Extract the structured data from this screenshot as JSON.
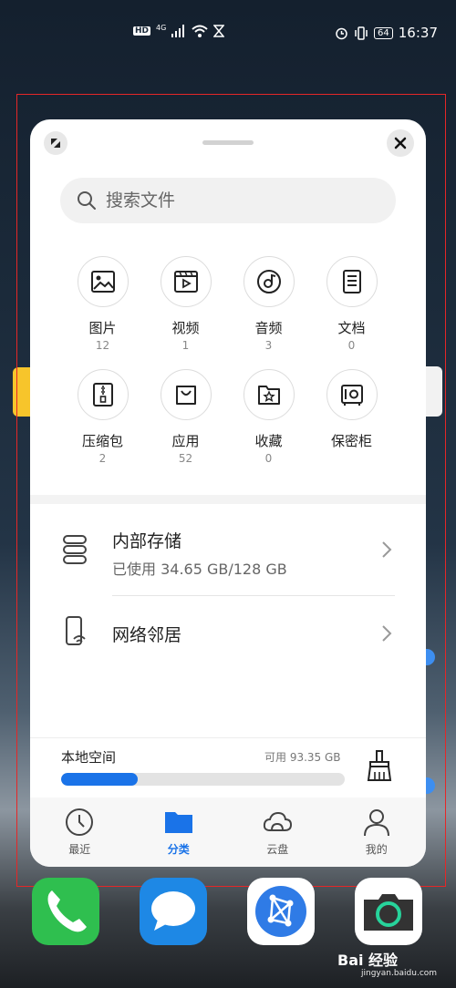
{
  "status_bar": {
    "hd": "HD",
    "network": "4G",
    "battery": "64",
    "time": "16:37"
  },
  "file_manager": {
    "search": {
      "placeholder": "搜索文件"
    },
    "categories": [
      {
        "name": "图片",
        "count": "12",
        "icon": "image-icon"
      },
      {
        "name": "视频",
        "count": "1",
        "icon": "video-icon"
      },
      {
        "name": "音频",
        "count": "3",
        "icon": "audio-icon"
      },
      {
        "name": "文档",
        "count": "0",
        "icon": "document-icon"
      },
      {
        "name": "压缩包",
        "count": "2",
        "icon": "zip-icon"
      },
      {
        "name": "应用",
        "count": "52",
        "icon": "app-bag-icon"
      },
      {
        "name": "收藏",
        "count": "0",
        "icon": "favorite-icon"
      },
      {
        "name": "保密柜",
        "count": "",
        "icon": "safe-icon"
      }
    ],
    "storage": {
      "title": "内部存储",
      "usage": "已使用 34.65 GB/128 GB"
    },
    "network_neighbor": {
      "title": "网络邻居"
    },
    "local_space": {
      "title": "本地空间",
      "available": "可用 93.35 GB",
      "used_fraction": 0.27
    },
    "bottom_nav": [
      {
        "label": "最近",
        "icon": "clock-icon",
        "active": false
      },
      {
        "label": "分类",
        "icon": "folder-icon",
        "active": true
      },
      {
        "label": "云盘",
        "icon": "cloud-icon",
        "active": false
      },
      {
        "label": "我的",
        "icon": "person-icon",
        "active": false
      }
    ]
  },
  "dock": {
    "apps": [
      {
        "name": "phone",
        "icon": "phone-icon",
        "color": "#2fbf4f"
      },
      {
        "name": "messages",
        "icon": "message-icon",
        "color": "#1e88e5"
      },
      {
        "name": "browser",
        "icon": "browser-icon",
        "color": "#ffffff"
      },
      {
        "name": "camera",
        "icon": "camera-icon",
        "color": "#ffffff"
      }
    ]
  },
  "watermark": {
    "text": "Bai 经验",
    "sub": "jingyan.baidu.com"
  },
  "colors": {
    "accent": "#1a73e8",
    "frame": "#e52727"
  }
}
